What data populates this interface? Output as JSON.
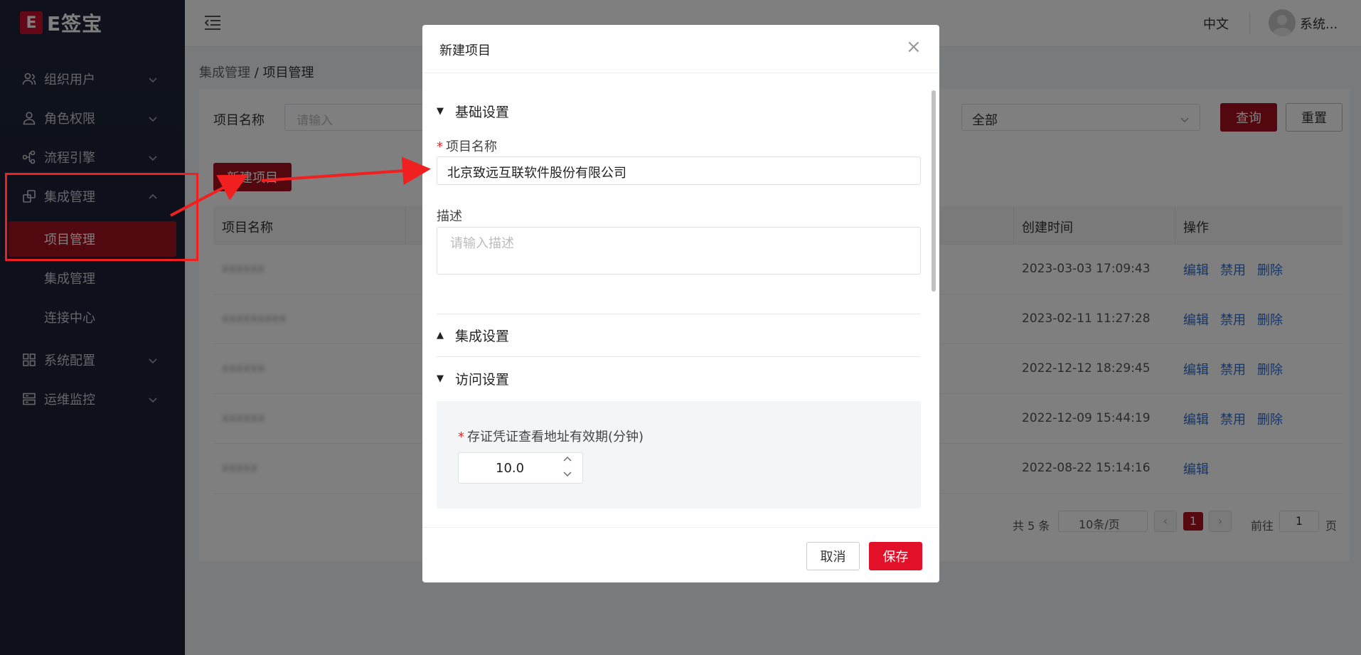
{
  "app": {
    "logo_mark": "E",
    "logo_text": "E签宝"
  },
  "sidebar": {
    "items": [
      {
        "label": "组织用户",
        "icon": "users-icon"
      },
      {
        "label": "角色权限",
        "icon": "user-icon"
      },
      {
        "label": "流程引擎",
        "icon": "flow-icon"
      },
      {
        "label": "集成管理",
        "icon": "integration-icon"
      },
      {
        "label": "系统配置",
        "icon": "grid-icon"
      },
      {
        "label": "运维监控",
        "icon": "monitor-icon"
      }
    ],
    "sub_items": [
      {
        "label": "项目管理",
        "active": true
      },
      {
        "label": "集成管理",
        "active": false
      },
      {
        "label": "连接中心",
        "active": false
      }
    ]
  },
  "header": {
    "language": "中文",
    "user_name": "系统..."
  },
  "breadcrumb": {
    "parent": "集成管理",
    "separator": " / ",
    "current": "项目管理"
  },
  "filter": {
    "name_label": "项目名称",
    "name_placeholder": "请输入",
    "status_value": "全部",
    "query_label": "查询",
    "reset_label": "重置"
  },
  "toolbar": {
    "new_project_label": "新建项目"
  },
  "table": {
    "headers": {
      "name": "项目名称",
      "created": "创建时间",
      "ops": "操作"
    },
    "rows": [
      {
        "name": "xxxxxx",
        "created": "2023-03-03 17:09:43",
        "ops": [
          "编辑",
          "禁用",
          "删除"
        ]
      },
      {
        "name": "xxxxxxxxx",
        "created": "2023-02-11 11:27:28",
        "ops": [
          "编辑",
          "禁用",
          "删除"
        ]
      },
      {
        "name": "xxxxxx",
        "created": "2022-12-12 18:29:45",
        "ops": [
          "编辑",
          "禁用",
          "删除"
        ]
      },
      {
        "name": "xxxxxx",
        "created": "2022-12-09 15:44:19",
        "ops": [
          "编辑",
          "禁用",
          "删除"
        ]
      },
      {
        "name": "xxxxx",
        "created": "2022-08-22 15:14:16",
        "ops": [
          "编辑"
        ]
      }
    ]
  },
  "pagination": {
    "total": "共 5 条",
    "page_size": "10条/页",
    "current": "1",
    "goto_label": "前往",
    "goto_value": "1",
    "page_suffix": "页"
  },
  "dialog": {
    "title": "新建项目",
    "basic_section": "基础设置",
    "name_label": "项目名称",
    "name_value": "北京致远互联软件股份有限公司",
    "desc_label": "描述",
    "desc_placeholder": "请输入描述",
    "integration_section": "集成设置",
    "access_section": "访问设置",
    "validity_label": "存证凭证查看地址有效期(分钟)",
    "validity_value": "10.0",
    "cancel_label": "取消",
    "save_label": "保存"
  },
  "colors": {
    "brand": "#a6101e",
    "save": "#e3102a",
    "annotation": "#f02020",
    "link": "#2c6dd2"
  }
}
